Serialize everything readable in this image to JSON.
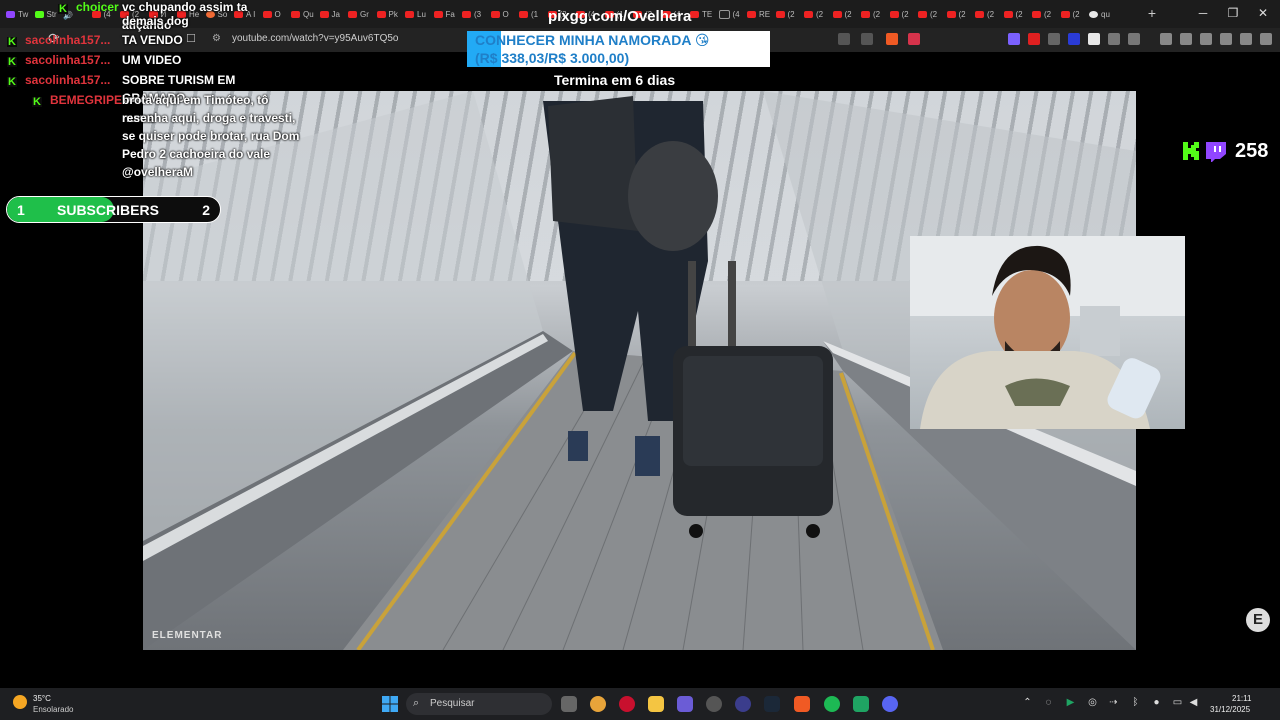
{
  "browser": {
    "tabs": [
      {
        "label": "Tw",
        "icon": "twitch-icon"
      },
      {
        "label": "Str",
        "icon": "kick-icon"
      },
      {
        "label": "",
        "icon": "speaker-icon"
      },
      {
        "label": "(4",
        "icon": "youtube-icon"
      },
      {
        "label": "(2",
        "icon": "youtube-icon"
      },
      {
        "label": "И",
        "icon": "youtube-icon"
      },
      {
        "label": "He",
        "icon": "youtube-icon"
      },
      {
        "label": "So",
        "icon": "tab-icon"
      },
      {
        "label": "A I",
        "icon": "youtube-icon"
      },
      {
        "label": "O",
        "icon": "youtube-icon"
      },
      {
        "label": "Qu",
        "icon": "youtube-icon"
      },
      {
        "label": "Ja",
        "icon": "youtube-icon"
      },
      {
        "label": "Gr",
        "icon": "youtube-icon"
      },
      {
        "label": "Pk",
        "icon": "youtube-icon"
      },
      {
        "label": "Lu",
        "icon": "youtube-icon"
      },
      {
        "label": "Fa",
        "icon": "youtube-icon"
      },
      {
        "label": "(3",
        "icon": "youtube-icon"
      },
      {
        "label": "O",
        "icon": "youtube-icon"
      },
      {
        "label": "(1",
        "icon": "youtube-icon"
      },
      {
        "label": "(2",
        "icon": "youtube-icon"
      },
      {
        "label": "(4",
        "icon": "youtube-icon"
      },
      {
        "label": "(1",
        "icon": "youtube-icon"
      },
      {
        "label": "(2",
        "icon": "youtube-icon"
      },
      {
        "label": "(4",
        "icon": "youtube-icon"
      },
      {
        "label": "TE",
        "icon": "youtube-icon"
      },
      {
        "label": "(4",
        "icon": "tiktok-icon"
      },
      {
        "label": "RE",
        "icon": "youtube-icon"
      },
      {
        "label": "(2",
        "icon": "youtube-icon"
      },
      {
        "label": "(2",
        "icon": "youtube-icon"
      },
      {
        "label": "(2",
        "icon": "youtube-icon"
      },
      {
        "label": "(2",
        "icon": "youtube-icon"
      },
      {
        "label": "(2",
        "icon": "youtube-icon"
      },
      {
        "label": "(2",
        "icon": "youtube-icon"
      },
      {
        "label": "(2",
        "icon": "youtube-icon"
      },
      {
        "label": "(2",
        "icon": "youtube-icon"
      },
      {
        "label": "(2",
        "icon": "youtube-icon"
      },
      {
        "label": "(2",
        "icon": "youtube-icon"
      },
      {
        "label": "(2",
        "icon": "youtube-icon"
      },
      {
        "label": "qu",
        "icon": "google-icon"
      }
    ],
    "url": "youtube.com/watch?v=y95Auv6TQ5o",
    "new_tab": "+",
    "minimize": "─",
    "maximize": "❐",
    "close": "✕"
  },
  "chat": {
    "lines": [
      {
        "user": "choicer",
        "user_color": "#53fc18",
        "message": "vc chupando assim ta atiçando"
      },
      {
        "user": "",
        "user_color": "#ffffff",
        "message": "demais dog"
      },
      {
        "user": "sacolinha157...",
        "user_color": "#e0343c",
        "message": "TA VENDO"
      },
      {
        "user": "sacolinha157...",
        "user_color": "#e0343c",
        "message": "UM VIDEO"
      },
      {
        "user": "sacolinha157...",
        "user_color": "#e0343c",
        "message": "SOBRE TURISM EM GRAMADO"
      },
      {
        "user": "BEMEGRIPE",
        "user_color": "#e0343c",
        "message": "brota aqui em Timóteo, tô numa"
      },
      {
        "user": "",
        "user_color": "#ffffff",
        "message": "resenha aqui, droga e travesti,"
      },
      {
        "user": "",
        "user_color": "#ffffff",
        "message": "se quiser pode brotar, rua Dom"
      },
      {
        "user": "",
        "user_color": "#ffffff",
        "message": "Pedro 2 cachoeira do vale"
      },
      {
        "user": "",
        "user_color": "#ffffff",
        "message": "@ovelheraM"
      }
    ]
  },
  "subscribers": {
    "left": "1",
    "label": "SUBSCRIBERS",
    "right": "2",
    "progress": 0.5
  },
  "goal": {
    "pix_url": "pixgg.com/Ovelhera",
    "title": "CONHECER MINHA NAMORADA 😘",
    "amount": "(R$ 338,03/R$ 3.000,00)",
    "progress": 0.113,
    "ends": "Termina em 6 dias"
  },
  "video": {
    "watermark": "ELEMENTAR"
  },
  "viewers": {
    "count": "258"
  },
  "taskbar": {
    "temperature": "35°C",
    "weather": "Ensolarado",
    "search_placeholder": "Pesquisar",
    "time": "21:11",
    "date": "31/12/2025"
  },
  "colors": {
    "kick_green": "#53fc18",
    "twitch_purple": "#9146ff",
    "goal_blue": "#22aaf5",
    "sub_green": "#1fbf4a"
  }
}
